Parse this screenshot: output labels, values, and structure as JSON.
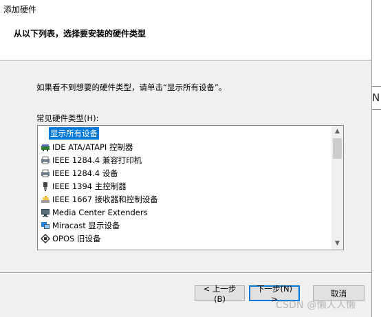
{
  "window": {
    "title": "添加硬件"
  },
  "header": {
    "subtitle": "从以下列表，选择要安装的硬件类型"
  },
  "instruction": "如果看不到想要的硬件类型，请单击“显示所有设备”。",
  "list": {
    "label": "常见硬件类型(H):",
    "items": [
      {
        "label": "显示所有设备",
        "icon": "none",
        "selected": true
      },
      {
        "label": "IDE ATA/ATAPI 控制器",
        "icon": "ide-controller-icon"
      },
      {
        "label": "IEEE 1284.4 兼容打印机",
        "icon": "printer-icon"
      },
      {
        "label": "IEEE 1284.4 设备",
        "icon": "printer-icon"
      },
      {
        "label": "IEEE 1394 主控制器",
        "icon": "firewire-icon"
      },
      {
        "label": "IEEE 1667 接收器和控制设备",
        "icon": "storage-icon"
      },
      {
        "label": "Media Center Extenders",
        "icon": "monitor-icon"
      },
      {
        "label": "Miracast 显示设备",
        "icon": "miracast-icon"
      },
      {
        "label": "OPOS 旧设备",
        "icon": "opos-icon"
      }
    ]
  },
  "buttons": {
    "back": "< 上一步(B)",
    "next": "下一步(N) >",
    "cancel": "取消"
  },
  "edge_glyph": "N",
  "watermark": "CSDN @懒人人懒",
  "colors": {
    "selection": "#0078d7",
    "default_button_border": "#0078d7"
  }
}
